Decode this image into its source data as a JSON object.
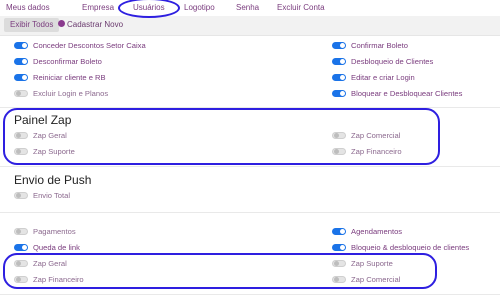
{
  "nav": {
    "tabs": [
      "Meus dados",
      "Empresa",
      "Usuários",
      "Logotipo",
      "Senha",
      "Excluir Conta"
    ]
  },
  "subbar": {
    "show_all": "Exibir Todos",
    "register_new": "Cadastrar Novo"
  },
  "permissions": {
    "left": [
      {
        "label": "Conceder Descontos Setor Caixa",
        "on": true
      },
      {
        "label": "Desconfirmar Boleto",
        "on": true
      },
      {
        "label": "Reiniciar cliente e RB",
        "on": true
      },
      {
        "label": "Excluir Login e Planos",
        "on": false
      }
    ],
    "right": [
      {
        "label": "Confirmar Boleto",
        "on": true
      },
      {
        "label": "Desbloqueio de Clientes",
        "on": true
      },
      {
        "label": "Editar e criar Login",
        "on": true
      },
      {
        "label": "Bloquear e Desbloquear Clientes",
        "on": true
      }
    ]
  },
  "painel_zap": {
    "title": "Painel Zap",
    "left": [
      {
        "label": "Zap Geral",
        "on": false
      },
      {
        "label": "Zap Suporte",
        "on": false
      }
    ],
    "right": [
      {
        "label": "Zap Comercial",
        "on": false
      },
      {
        "label": "Zap Financeiro",
        "on": false
      }
    ]
  },
  "push": {
    "title": "Envio de Push",
    "items": [
      {
        "label": "Envio Total",
        "on": false
      }
    ]
  },
  "notifications": {
    "left": [
      {
        "label": "Pagamentos",
        "on": false
      },
      {
        "label": "Queda de link",
        "on": true
      },
      {
        "label": "Zap Geral",
        "on": false
      },
      {
        "label": "Zap Financeiro",
        "on": false
      }
    ],
    "right": [
      {
        "label": "Agendamentos",
        "on": true
      },
      {
        "label": "Bloqueio & desbloqueio de clientes",
        "on": true
      },
      {
        "label": "Zap Suporte",
        "on": false
      },
      {
        "label": "Zap Comercial",
        "on": false
      }
    ]
  },
  "colors": {
    "toggle_on": "#1a73e8",
    "text": "#7a3c7e",
    "annotation": "#2e1fe0"
  }
}
